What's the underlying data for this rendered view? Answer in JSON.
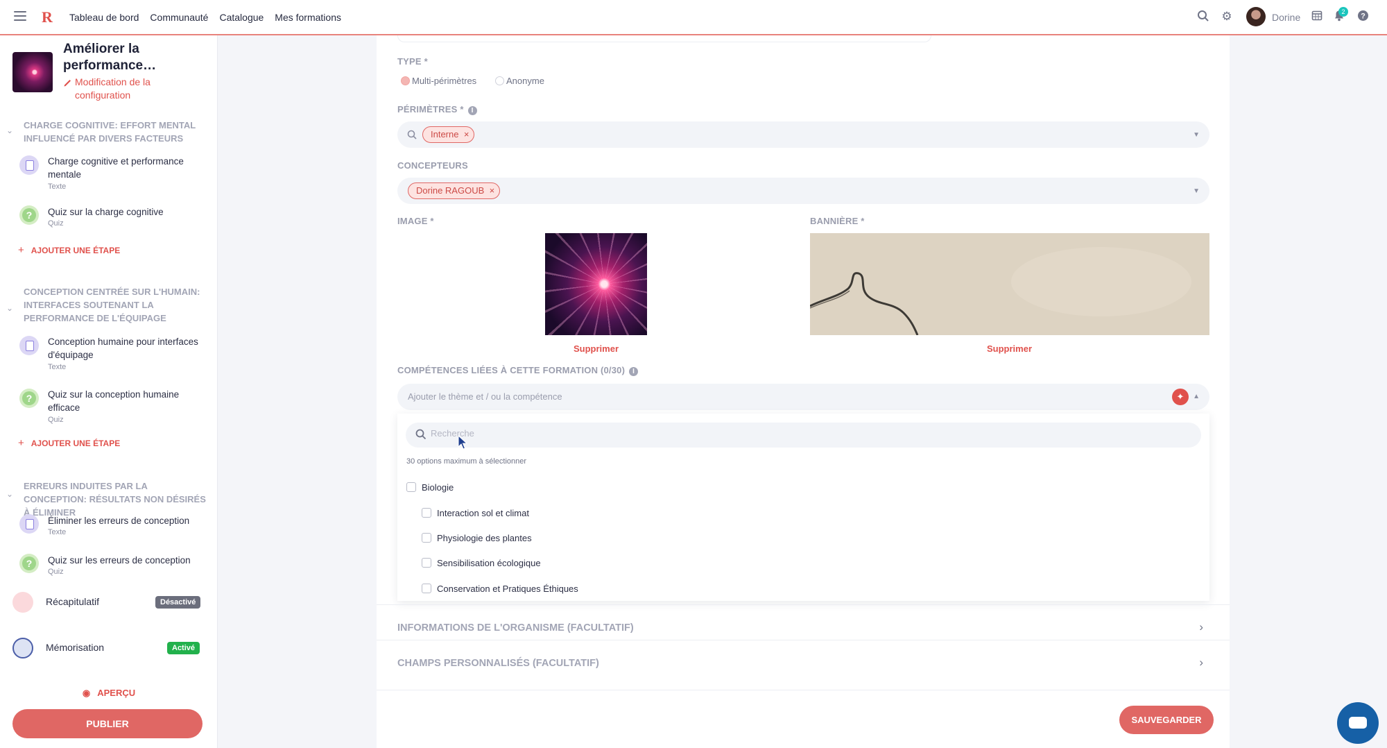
{
  "topbar": {
    "logo": "R",
    "nav": [
      "Tableau de bord",
      "Communauté",
      "Catalogue",
      "Mes formations"
    ],
    "user_name": "Dorine",
    "notif_count": "2",
    "icons": [
      "search-icon",
      "gear-icon",
      "calendar-icon",
      "bell-icon",
      "help-icon"
    ]
  },
  "sidebar": {
    "course_title": "Améliorer la performance…",
    "edit_link": "Modification de la configuration",
    "sections": [
      {
        "title": "CHARGE COGNITIVE: EFFORT MENTAL INFLUENCÉ PAR DIVERS FACTEURS",
        "steps": [
          {
            "title": "Charge cognitive et performance mentale",
            "type": "Texte"
          },
          {
            "title": "Quiz sur la charge cognitive",
            "type": "Quiz"
          }
        ],
        "add_step": "AJOUTER UNE ÉTAPE"
      },
      {
        "title": "CONCEPTION CENTRÉE SUR L'HUMAIN: INTERFACES SOUTENANT LA PERFORMANCE DE L'ÉQUIPAGE",
        "steps": [
          {
            "title": "Conception humaine pour interfaces d'équipage",
            "type": "Texte"
          },
          {
            "title": "Quiz sur la conception humaine efficace",
            "type": "Quiz"
          }
        ],
        "add_step": "AJOUTER UNE ÉTAPE"
      },
      {
        "title": "ERREURS INDUITES PAR LA CONCEPTION: RÉSULTATS NON DÉSIRÉS À ÉLIMINER",
        "steps": [
          {
            "title": "Éliminer les erreurs de conception",
            "type": "Texte"
          },
          {
            "title": "Quiz sur les erreurs de conception",
            "type": "Quiz"
          }
        ]
      }
    ],
    "recap": {
      "label": "Récapitulatif",
      "badge": "Désactivé",
      "badge_color": "#6b6e7c"
    },
    "memo": {
      "label": "Mémorisation",
      "badge": "Activé",
      "badge_color": "#22b14c"
    },
    "preview": "APERÇU",
    "publish": "PUBLIER"
  },
  "form": {
    "type_label": "TYPE *",
    "type_options": [
      "Multi-périmètres",
      "Anonyme"
    ],
    "type_selected": "Multi-périmètres",
    "perimetres_label": "PÉRIMÈTRES *",
    "perimetres_chips": [
      "Interne"
    ],
    "concepteurs_label": "CONCEPTEURS",
    "concepteurs_chips": [
      "Dorine RAGOUB"
    ],
    "image_label": "IMAGE *",
    "banner_label": "BANNIÈRE *",
    "delete_label": "Supprimer",
    "competences_label": "COMPÉTENCES LIÉES À CETTE FORMATION (0/30)",
    "competences_placeholder": "Ajouter le thème et / ou la compétence",
    "dropdown": {
      "search_placeholder": "Recherche",
      "note": "30 options maximum à sélectionner",
      "parent": "Biologie",
      "children": [
        "Interaction sol et climat",
        "Physiologie des plantes",
        "Sensibilisation écologique",
        "Conservation et Pratiques Éthiques"
      ]
    },
    "sections": [
      "INFORMATIONS DE L'ORGANISME (FACULTATIF)",
      "CHAMPS PERSONNALISÉS (FACULTATIF)"
    ],
    "save": "SAUVEGARDER"
  },
  "colors": {
    "accent": "#e06764",
    "accent_dark": "#e0514c",
    "chat": "#1660a6"
  }
}
